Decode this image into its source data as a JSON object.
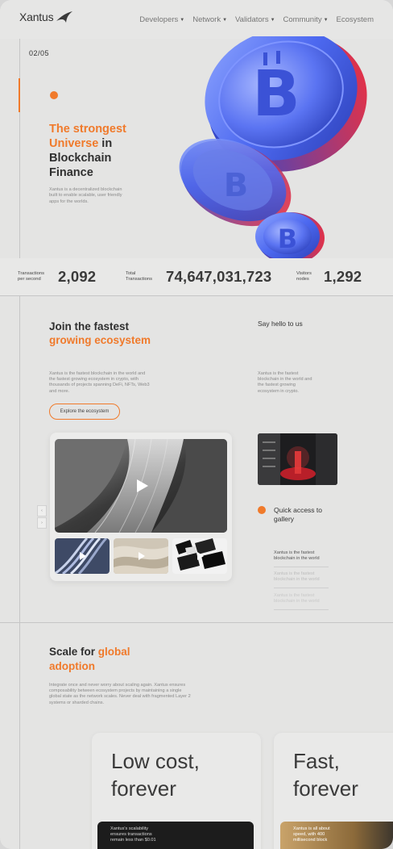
{
  "header": {
    "logo": "Xantus",
    "nav": [
      {
        "label": "Developers",
        "has_menu": true
      },
      {
        "label": "Network",
        "has_menu": true
      },
      {
        "label": "Validators",
        "has_menu": true
      },
      {
        "label": "Community",
        "has_menu": true
      },
      {
        "label": "Ecosystem",
        "has_menu": false
      }
    ]
  },
  "hero": {
    "slide_counter": "02/05",
    "title_accent": "The strongest Universe",
    "title_rest": " in Blockchain Finance",
    "description": "Xantus is a decentralized blockchain built to enable scalable, user friendly apps for the worlds."
  },
  "stats": [
    {
      "label": "Transactions per second",
      "value": "2,092"
    },
    {
      "label": "Total Transactions",
      "value": "74,647,031,723"
    },
    {
      "label": "Visitors nodes",
      "value": "1,292"
    }
  ],
  "ecosystem": {
    "title_plain": "Join the fastest ",
    "title_accent": "growing ecosystem",
    "description": "Xantus is the fastest blockchain in the world and the fastest growing ecosystem in crypto, with thousands of projects spanning DeFi, NFTs, Web3 and more.",
    "button": "Explore the ecosystem"
  },
  "hello": {
    "title": "Say hello to us",
    "description": "Xantus is the fastest blockchain in the world and the fastest growing ecosystem in crypto."
  },
  "gallery": {
    "prev_icon": "‹",
    "next_icon": "›",
    "quick_access": "Quick access to gallery",
    "items": [
      "Xantus is the fastest blockchain in the world",
      "Xantus is the fastest blockchain in the world",
      "Xantus is the fastest blockchain in the world"
    ]
  },
  "scale": {
    "title_plain": "Scale for ",
    "title_accent": "global adoption",
    "description": "Integrate once and never worry about scaling again. Xantus ensures composability between ecosystem projects by maintaining a single global state as the network scales. Never deal with fragmented Layer 2 systems or sharded chains."
  },
  "features": [
    {
      "title": "Low cost, forever",
      "text": "Xantus's scalability ensures transactions remain less than $0.01"
    },
    {
      "title": "Fast, forever",
      "text": "Xantus is all about speed, with 400 millisecond block"
    }
  ],
  "colors": {
    "accent": "#f07a2b",
    "text": "#2f2f2f",
    "muted": "#8a8a8a"
  }
}
